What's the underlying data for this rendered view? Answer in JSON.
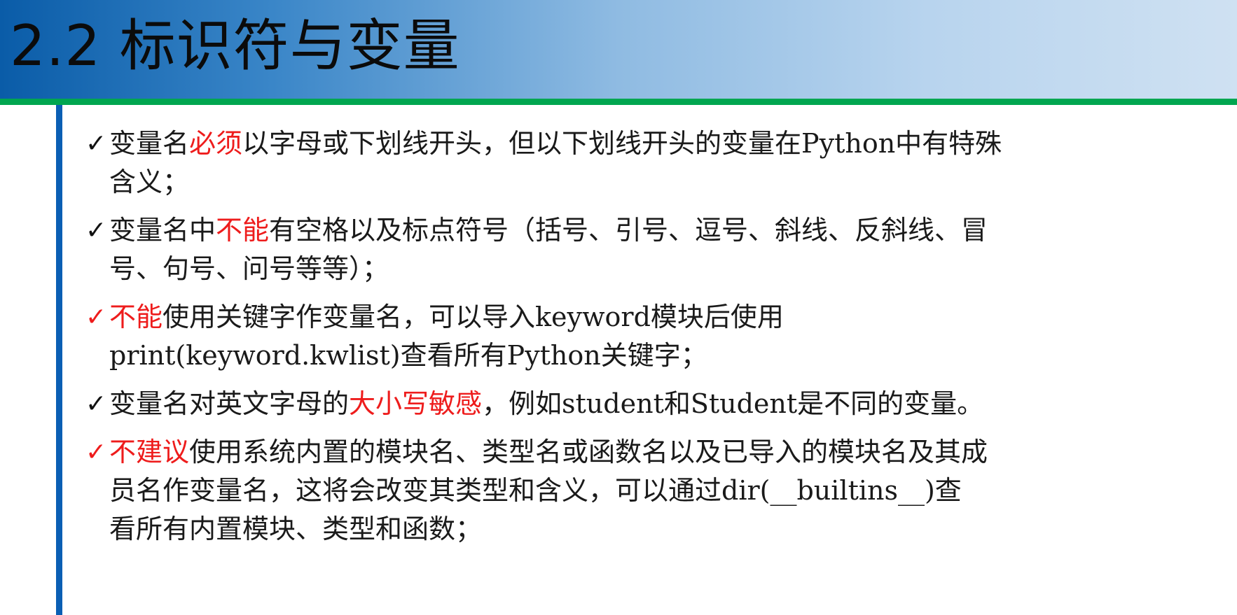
{
  "slide": {
    "title": "2.2 标识符与变量"
  },
  "colors": {
    "header_gradient_start": "#0a5ca8",
    "header_gradient_end": "#cfe1f2",
    "green_rule": "#00a650",
    "blue_rule": "#0a5fb4",
    "highlight_red": "#ee1c1c",
    "body_text": "#1a1a1a"
  },
  "bullets": [
    {
      "check_icon": "checkmark-icon",
      "check_red": false,
      "line1": {
        "a": "变量名",
        "hl": "必须",
        "b": "以字母或下划线开头，但以下划线开头的变量在Python中有特殊"
      },
      "line2": "含义；"
    },
    {
      "check_icon": "checkmark-icon",
      "check_red": false,
      "line1": {
        "a": "变量名中",
        "hl": "不能",
        "b": "有空格以及标点符号（括号、引号、逗号、斜线、反斜线、冒"
      },
      "line2": "号、句号、问号等等）；"
    },
    {
      "check_icon": "checkmark-icon",
      "check_red": true,
      "line1": {
        "a": "",
        "hl": "不能",
        "b": "使用关键字作变量名，可以导入keyword模块后使用"
      },
      "line2": "print(keyword.kwlist)查看所有Python关键字；"
    },
    {
      "check_icon": "checkmark-icon",
      "check_red": false,
      "line1": {
        "a": "变量名对英文字母的",
        "hl": "大小写敏感",
        "b": "，例如student和Student是不同的变量。"
      }
    },
    {
      "check_icon": "checkmark-icon",
      "check_red": true,
      "line1": {
        "a": "",
        "hl": "不建议",
        "b": "使用系统内置的模块名、类型名或函数名以及已导入的模块名及其成"
      },
      "line2": "员名作变量名，这将会改变其类型和含义，可以通过dir(__builtins__)查",
      "line3": "看所有内置模块、类型和函数；"
    }
  ]
}
